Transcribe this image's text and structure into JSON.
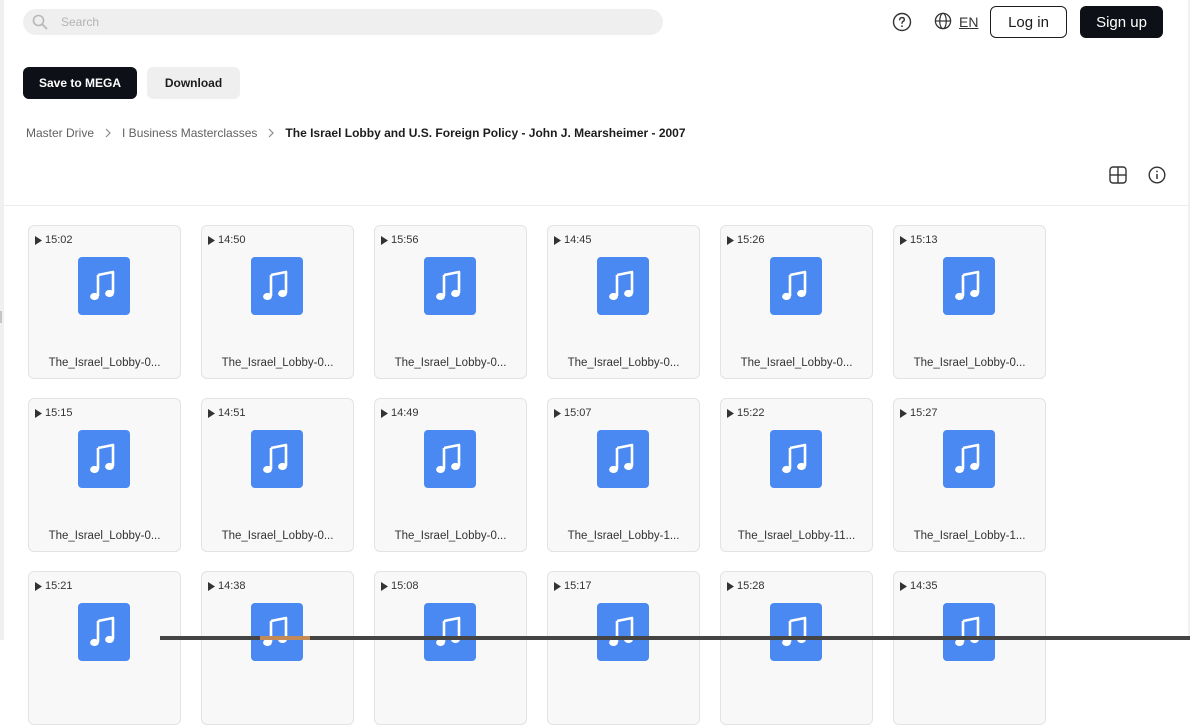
{
  "header": {
    "search_placeholder": "Search",
    "language": "EN",
    "login_label": "Log in",
    "signup_label": "Sign up"
  },
  "actions": {
    "save_label": "Save to MEGA",
    "download_label": "Download"
  },
  "breadcrumb": [
    "Master Drive",
    "I Business Masterclasses",
    "The Israel Lobby and U.S. Foreign Policy - John J. Mearsheimer - 2007"
  ],
  "icons": {
    "search": "search-icon",
    "help": "help-icon",
    "language": "globe-icon",
    "view": "grid-view-icon",
    "info": "info-icon",
    "file": "music-file-icon",
    "play": "play-icon"
  },
  "colors": {
    "primary_button": "#0d1117",
    "music_tile": "#4a88f2",
    "secondary_button": "#efefef"
  },
  "files": [
    {
      "duration": "15:02",
      "name": "The_Israel_Lobby-0..."
    },
    {
      "duration": "14:50",
      "name": "The_Israel_Lobby-0..."
    },
    {
      "duration": "15:56",
      "name": "The_Israel_Lobby-0..."
    },
    {
      "duration": "14:45",
      "name": "The_Israel_Lobby-0..."
    },
    {
      "duration": "15:26",
      "name": "The_Israel_Lobby-0..."
    },
    {
      "duration": "15:13",
      "name": "The_Israel_Lobby-0..."
    },
    {
      "duration": "15:15",
      "name": "The_Israel_Lobby-0..."
    },
    {
      "duration": "14:51",
      "name": "The_Israel_Lobby-0..."
    },
    {
      "duration": "14:49",
      "name": "The_Israel_Lobby-0..."
    },
    {
      "duration": "15:07",
      "name": "The_Israel_Lobby-1..."
    },
    {
      "duration": "15:22",
      "name": "The_Israel_Lobby-11..."
    },
    {
      "duration": "15:27",
      "name": "The_Israel_Lobby-1..."
    },
    {
      "duration": "15:21",
      "name": ""
    },
    {
      "duration": "14:38",
      "name": ""
    },
    {
      "duration": "15:08",
      "name": ""
    },
    {
      "duration": "15:17",
      "name": ""
    },
    {
      "duration": "15:28",
      "name": ""
    },
    {
      "duration": "14:35",
      "name": ""
    }
  ]
}
